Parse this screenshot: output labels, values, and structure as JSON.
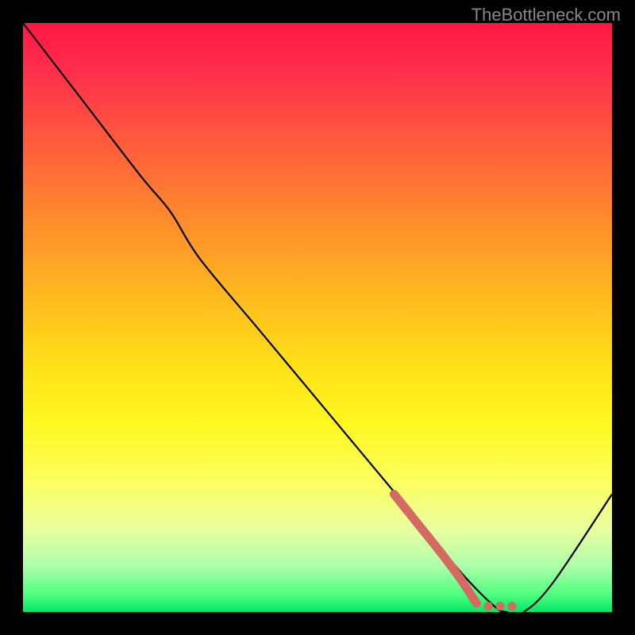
{
  "watermark": "TheBottleneck.com",
  "chart_data": {
    "type": "line",
    "title": "",
    "xlabel": "",
    "ylabel": "",
    "xlim": [
      0,
      100
    ],
    "ylim": [
      0,
      100
    ],
    "series": [
      {
        "name": "main-curve",
        "stroke": "#000000",
        "x": [
          0,
          10,
          20,
          25,
          30,
          40,
          50,
          60,
          70,
          75,
          80,
          82,
          85,
          90,
          100
        ],
        "y": [
          100,
          87,
          74,
          68,
          60,
          48,
          36,
          24,
          12,
          6,
          1,
          0,
          0,
          5,
          20
        ]
      },
      {
        "name": "highlight-segment",
        "stroke": "#d46a61",
        "style": "thick-dotted-tail",
        "x": [
          63,
          67,
          71,
          74,
          76,
          77,
          79,
          81,
          83
        ],
        "y": [
          20,
          15,
          10,
          6,
          3,
          1.5,
          1,
          1,
          1
        ]
      }
    ]
  }
}
